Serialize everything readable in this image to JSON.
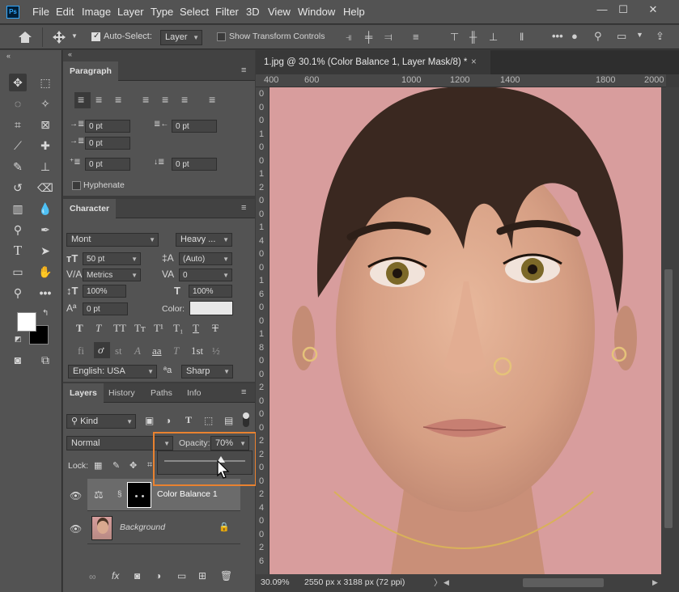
{
  "app": {
    "logo": "Ps"
  },
  "menu": [
    "File",
    "Edit",
    "Image",
    "Layer",
    "Type",
    "Select",
    "Filter",
    "3D",
    "View",
    "Window",
    "Help"
  ],
  "window_controls": {
    "minimize": "—",
    "maximize": "☐",
    "close": "✕"
  },
  "options_bar": {
    "auto_select_label": "Auto-Select:",
    "auto_select_value": "Layer",
    "show_transform_label": "Show Transform Controls"
  },
  "paragraph_panel": {
    "title": "Paragraph",
    "indent_left": "0 pt",
    "indent_right": "0 pt",
    "indent_first": "0 pt",
    "space_before": "0 pt",
    "space_after": "0 pt",
    "hyphenate_label": "Hyphenate"
  },
  "character_panel": {
    "title": "Character",
    "font_family": "Mont",
    "font_style": "Heavy ...",
    "font_size": "50 pt",
    "leading": "(Auto)",
    "kerning": "Metrics",
    "tracking": "0",
    "vertical_scale": "100%",
    "horizontal_scale": "100%",
    "baseline_shift": "0 pt",
    "color_label": "Color:",
    "language": "English: USA",
    "aa_label": "ªa",
    "antialias": "Sharp",
    "style_buttons": [
      "T",
      "T",
      "TT",
      "Tт",
      "T¹",
      "T₁",
      "T",
      "T"
    ],
    "ot_buttons": [
      "fi",
      "ơ",
      "st",
      "A",
      "aa",
      "T",
      "1st",
      "½"
    ]
  },
  "layers_panel": {
    "tabs": [
      "Layers",
      "History",
      "Paths",
      "Info"
    ],
    "filter_kind": "Kind",
    "blend_mode": "Normal",
    "opacity_label": "Opacity:",
    "opacity_value": "70%",
    "opacity": 0.7,
    "lock_label": "Lock:",
    "layers": [
      {
        "name": "Color Balance 1"
      },
      {
        "name": "Background"
      }
    ]
  },
  "document": {
    "tab_title": "1.jpg @ 30.1% (Color Balance 1, Layer Mask/8) *",
    "close": "×",
    "zoom": "30.09%",
    "info": "2550 px x 3188 px (72 ppi)",
    "ruler_h": [
      "400",
      "600",
      "1000",
      "1200",
      "1400",
      "1800",
      "2000"
    ],
    "ruler_v": [
      "0",
      "0",
      "0",
      "1",
      "0",
      "0",
      "1",
      "2",
      "0",
      "0",
      "1",
      "4",
      "0",
      "0",
      "1",
      "6",
      "0",
      "0",
      "1",
      "8",
      "0",
      "0",
      "2",
      "0",
      "0",
      "0",
      "2",
      "2",
      "0",
      "0",
      "2",
      "4",
      "0",
      "0",
      "2",
      "6"
    ]
  },
  "colors": {
    "accent": "#e98230",
    "panel": "#535353",
    "canvas_bg": "#d69d9c"
  }
}
